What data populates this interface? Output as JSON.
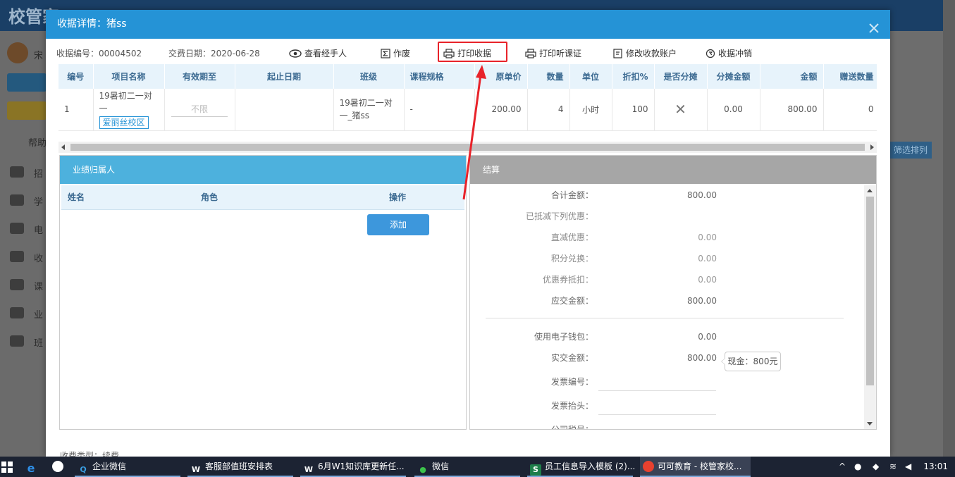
{
  "background_app": {
    "logo": "校管家",
    "user_name": "宋",
    "sidebar_labels": [
      "帮助",
      "招",
      "学",
      "电",
      "收",
      "课",
      "业",
      "班"
    ],
    "right_button": "筛选排列"
  },
  "modal": {
    "title": "收据详情：猪ss",
    "receipt_no_label": "收据编号：",
    "receipt_no": "00004502",
    "pay_date_label": "交费日期：",
    "pay_date": "2020-06-28",
    "actions": {
      "view_handler": "查看经手人",
      "void": "作废",
      "print_receipt": "打印收据",
      "print_voucher": "打印听课证",
      "edit_account": "修改收款账户",
      "reverse": "收据冲销"
    }
  },
  "items_table": {
    "headers": [
      "编号",
      "项目名称",
      "有效期至",
      "起止日期",
      "班级",
      "课程规格",
      "原单价",
      "数量",
      "单位",
      "折扣%",
      "是否分摊",
      "分摊金额",
      "金额",
      "赠送数量"
    ],
    "rows": [
      {
        "no": "1",
        "project_name": "19暑初二一对一",
        "campus_tag": "爱丽丝校区",
        "valid_until": "不限",
        "date_range": "",
        "class_name": "19暑初二一对一_猪ss",
        "spec": "-",
        "unit_price": "200.00",
        "qty": "4",
        "unit": "小时",
        "discount": "100",
        "shared": "✕",
        "shared_amount": "0.00",
        "amount": "800.00",
        "gift_qty": "0"
      }
    ]
  },
  "performance_panel": {
    "title": "业绩归属人",
    "col_name": "姓名",
    "col_role": "角色",
    "col_action": "操作",
    "add_button": "添加"
  },
  "settlement_panel": {
    "title": "结算",
    "rows": [
      {
        "label": "合计金额：",
        "value": "800.00"
      },
      {
        "label": "已抵减下列优惠：",
        "value": ""
      },
      {
        "label": "直减优惠：",
        "value": "0.00"
      },
      {
        "label": "积分兑换：",
        "value": "0.00"
      },
      {
        "label": "优惠券抵扣：",
        "value": "0.00"
      },
      {
        "label": "应交金额：",
        "value": "800.00"
      },
      {
        "label": "使用电子钱包：",
        "value": "0.00"
      },
      {
        "label": "实交金额：",
        "value": "800.00"
      }
    ],
    "cash_tip": "现金：800元",
    "invoice_no_label": "发票编号：",
    "invoice_title_label": "发票抬头：",
    "company_tax_label": "公司税号："
  },
  "footer_partial": "收费类型：续费",
  "taskbar": {
    "items": [
      "企业微信",
      "客服部值班安排表",
      "6月W1知识库更新任...",
      "微信",
      "员工信息导入模板 (2)...",
      "可可教育 - 校管家校..."
    ],
    "clock": "13:01"
  },
  "colors": {
    "header_blue": "#2593d6",
    "panel_blue": "#4db1dd",
    "panel_gray": "#a6a6a6",
    "highlight_red": "#e8232a"
  }
}
